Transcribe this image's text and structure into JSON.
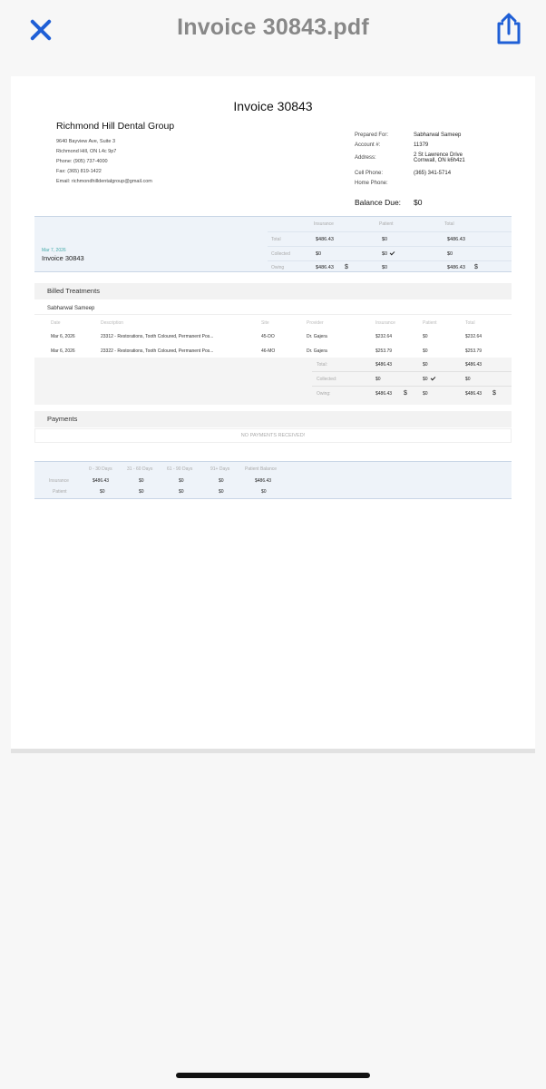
{
  "nav": {
    "title": "Invoice 30843.pdf"
  },
  "pdf": {
    "invoice_title": "Invoice 30843",
    "company": {
      "name": "Richmond Hill Dental Group",
      "address1": "9640 Bayview Ave, Suite 3",
      "address2": "Richmond Hill, ON L4c 9p7",
      "phone": "Phone: (905) 737-4000",
      "fax": "Fax: (365) 819-1422",
      "email": "Email: richmondhilldentalgroup@gmail.com"
    },
    "prepared": {
      "prepared_for_label": "Prepared For:",
      "prepared_for": "Sabharwal Sameep",
      "account_label": "Account #:",
      "account": "11379",
      "address_label": "Address:",
      "address_line1": "2 St Lawrence Drive",
      "address_line2": "Cornwall, ON k6h4z1",
      "cell_label": "Cell Phone:",
      "cell": "(365) 341-5714",
      "home_label": "Home Phone:"
    },
    "balance_label": "Balance Due:",
    "balance_value": "$0",
    "summary": {
      "headers": {
        "insurance": "Insurance",
        "patient": "Patient",
        "total": "Total"
      },
      "date": "Mar 7, 2026",
      "invoice": "Invoice 30843",
      "rows": [
        {
          "label": "Total",
          "insurance": "$486.43",
          "patient": "$0",
          "total": "$486.43"
        },
        {
          "label": "Collected",
          "insurance": "$0",
          "patient": "$0",
          "total": "$0"
        },
        {
          "label": "Owing",
          "insurance": "$486.43",
          "patient": "$0",
          "total": "$486.43"
        }
      ],
      "dollar_sign": "$"
    },
    "billed_title": "Billed Treatments",
    "patient_name": "Sabharwal Sameep",
    "treatments": {
      "headers": {
        "date": "Date",
        "description": "Description",
        "site": "Site",
        "provider": "Provider",
        "insurance": "Insurance",
        "patient": "Patient",
        "total": "Total"
      },
      "rows": [
        {
          "date": "Mar 6, 2026",
          "description": "23312 - Restorations, Tooth Coloured, Permanent Pos...",
          "site": "45-DO",
          "provider": "Dr. Gajera",
          "insurance": "$232.64",
          "patient": "$0",
          "total": "$232.64"
        },
        {
          "date": "Mar 6, 2026",
          "description": "23322 - Restorations, Tooth Coloured, Permanent Pos...",
          "site": "46-MO",
          "provider": "Dr. Gajera",
          "insurance": "$253.79",
          "patient": "$0",
          "total": "$253.79"
        }
      ],
      "totals": [
        {
          "label": "Total:",
          "insurance": "$486.43",
          "patient": "$0",
          "total": "$486.43"
        },
        {
          "label": "Collected:",
          "insurance": "$0",
          "patient": "$0",
          "total": "$0"
        },
        {
          "label": "Owing:",
          "insurance": "$486.43",
          "patient": "$0",
          "total": "$486.43"
        }
      ]
    },
    "payments_title": "Payments",
    "no_payments": "NO PAYMENTS RECEIVED!",
    "aging": {
      "headers": [
        "0 - 30 Days",
        "31 - 60 Days",
        "61 - 90 Days",
        "91+ Days",
        "Patient Balance"
      ],
      "insurance_label": "Insurance",
      "patient_label": "Patient",
      "insurance": [
        "$486.43",
        "$0",
        "$0",
        "$0",
        "$486.43"
      ],
      "patient": [
        "$0",
        "$0",
        "$0",
        "$0",
        "$0"
      ]
    }
  }
}
